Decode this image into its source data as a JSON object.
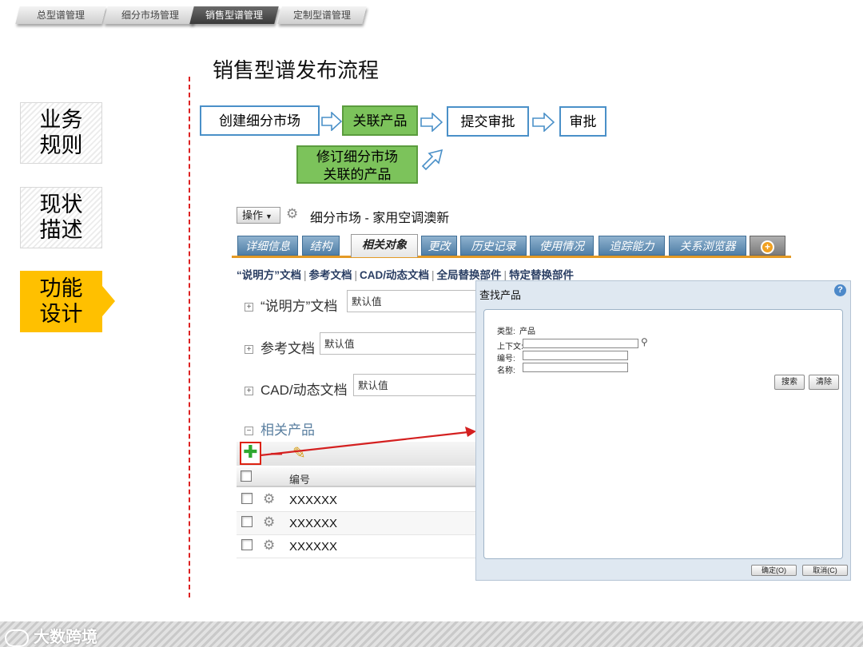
{
  "top_tabs": [
    {
      "label": "总型谱管理",
      "active": false
    },
    {
      "label": "细分市场管理",
      "active": false
    },
    {
      "label": "销售型谱管理",
      "active": true
    },
    {
      "label": "定制型谱管理",
      "active": false
    }
  ],
  "side_nav": [
    {
      "line1": "业务",
      "line2": "规则",
      "active": false
    },
    {
      "line1": "现状",
      "line2": "描述",
      "active": false
    },
    {
      "line1": "功能",
      "line2": "设计",
      "active": true
    }
  ],
  "title": "销售型谱发布流程",
  "flow": {
    "step1": "创建细分市场",
    "step2": "关联产品",
    "step3": "提交审批",
    "step4": "审批",
    "step_revise_line1": "修订细分市场",
    "step_revise_line2": "关联的产品"
  },
  "app": {
    "operate_button": "操作",
    "context_title": "细分市场 - 家用空调澳新",
    "tabs": [
      "详细信息",
      "结构",
      "相关对象",
      "更改",
      "历史记录",
      "使用情况",
      "追踪能力",
      "关系浏览器"
    ],
    "selected_tab": "相关对象",
    "sub_links": [
      "“说明方”文档",
      "参考文档",
      "CAD/动态文档",
      "全局替换部件",
      "特定替换部件"
    ],
    "sections": [
      {
        "label": "“说明方”文档",
        "default": "默认值"
      },
      {
        "label": "参考文档",
        "default": "默认值"
      },
      {
        "label": "CAD/动态文档",
        "default": "默认值"
      }
    ],
    "related_products_label": "相关产品",
    "grid_header": "编号",
    "grid_rows": [
      "XXXXXX",
      "XXXXXX",
      "XXXXXX"
    ]
  },
  "dialog": {
    "title": "查找产品",
    "help": "?",
    "type_label": "类型:",
    "type_value": "产品",
    "context_label": "上下文:",
    "number_label": "编号:",
    "name_label": "名称:",
    "search_button": "搜索",
    "clear_button": "清除",
    "ok_button": "确定(O)",
    "cancel_button": "取消(C)"
  },
  "footer_brand": "大数跨境",
  "colors": {
    "accent_yellow": "#ffc000",
    "flow_green": "#7cc35b",
    "flow_border_blue": "#4a90c8",
    "tab_orange": "#e49a25",
    "divider_red": "#dd2222"
  }
}
